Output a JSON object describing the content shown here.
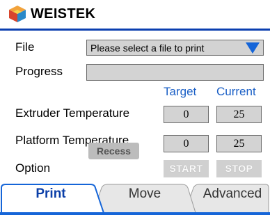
{
  "app": {
    "brand": "WEISTEK"
  },
  "file": {
    "label": "File",
    "placeholder": "Please select a file to print"
  },
  "progress": {
    "label": "Progress",
    "value": 0
  },
  "columns": {
    "target": "Target",
    "current": "Current"
  },
  "extruder": {
    "label": "Extruder Temperature",
    "target": "0",
    "current": "25"
  },
  "platform": {
    "label": "Platform Temperature",
    "target": "0",
    "current": "25"
  },
  "tooltip": {
    "text": "Recess"
  },
  "option": {
    "label": "Option",
    "start": "START",
    "stop": "STOP"
  },
  "tabs": {
    "print": "Print",
    "move": "Move",
    "advanced": "Advanced"
  },
  "colors": {
    "accent": "#1565d8",
    "field": "#d3d3d3",
    "header_rule": "#0b3fb0"
  }
}
